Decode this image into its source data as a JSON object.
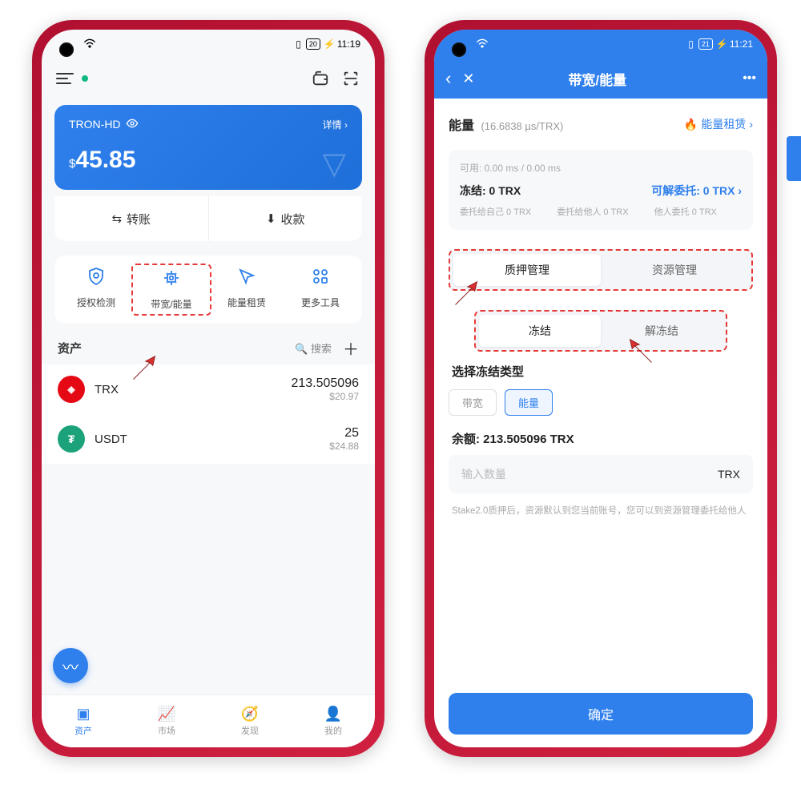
{
  "left": {
    "status": {
      "battery": "20",
      "time": "11:19"
    },
    "wallet": {
      "name": "TRON-HD",
      "detail": "详情",
      "currency": "$",
      "balance": "45.85"
    },
    "actions": {
      "transfer": "转账",
      "receive": "收款"
    },
    "tools": [
      {
        "label": "授权检测"
      },
      {
        "label": "带宽/能量"
      },
      {
        "label": "能量租赁"
      },
      {
        "label": "更多工具"
      }
    ],
    "assets_title": "资产",
    "search": "搜索",
    "assets": [
      {
        "sym": "TRX",
        "amount": "213.505096",
        "usd": "$20.97"
      },
      {
        "sym": "USDT",
        "amount": "25",
        "usd": "$24.88"
      }
    ],
    "tabs": [
      {
        "label": "资产"
      },
      {
        "label": "市场"
      },
      {
        "label": "发现"
      },
      {
        "label": "我的"
      }
    ]
  },
  "right": {
    "status": {
      "battery": "21",
      "time": "11:21"
    },
    "title": "带宽/能量",
    "energy_label": "能量",
    "energy_rate": "(16.6838 µs/TRX)",
    "rent_label": "能量租赁",
    "available": "可用: 0.00 ms / 0.00 ms",
    "frozen": "冻结: 0 TRX",
    "delegatable": "可解委托: 0 TRX",
    "cols": [
      "委托给自己 0 TRX",
      "委托给他人 0 TRX",
      "他人委托 0 TRX"
    ],
    "seg1": [
      "质押管理",
      "资源管理"
    ],
    "seg2": [
      "冻结",
      "解冻结"
    ],
    "type_title": "选择冻结类型",
    "types": [
      "带宽",
      "能量"
    ],
    "balance_label": "余额: 213.505096 TRX",
    "input_placeholder": "输入数量",
    "unit": "TRX",
    "hint": "Stake2.0质押后，资源默认到您当前账号，您可以到资源管理委托给他人",
    "confirm": "确定"
  }
}
